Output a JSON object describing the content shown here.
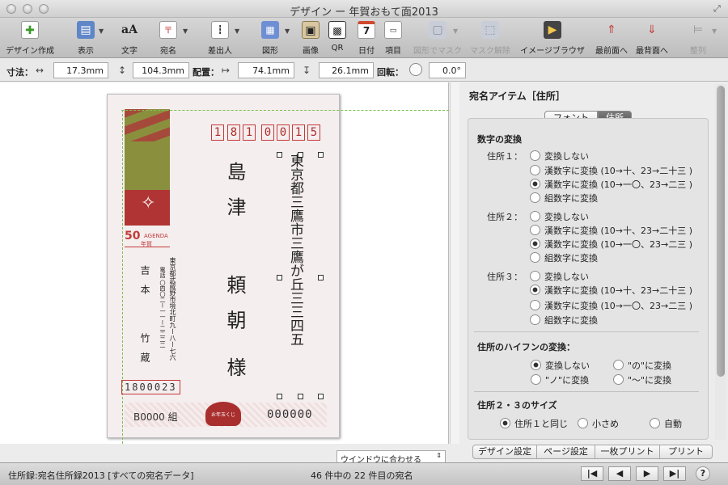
{
  "window": {
    "title": "デザイン ー 年賀おもて面2013"
  },
  "toolbar": {
    "items": [
      {
        "label": "デザイン作成",
        "icon": "design-create-icon"
      },
      {
        "label": "表示",
        "icon": "view-icon"
      },
      {
        "label": "文字",
        "icon": "text-icon"
      },
      {
        "label": "宛名",
        "icon": "address-icon"
      },
      {
        "label": "差出人",
        "icon": "sender-icon"
      },
      {
        "label": "図形",
        "icon": "shape-icon"
      },
      {
        "label": "画像",
        "icon": "image-icon"
      },
      {
        "label": "QR",
        "icon": "qr-icon"
      },
      {
        "label": "日付",
        "icon": "calendar-icon"
      },
      {
        "label": "項目",
        "icon": "field-icon"
      },
      {
        "label": "図形でマスク",
        "icon": "mask-shape-icon"
      },
      {
        "label": "マスク解除",
        "icon": "mask-release-icon"
      },
      {
        "label": "イメージブラウザ",
        "icon": "image-browser-icon"
      },
      {
        "label": "最前面へ",
        "icon": "bring-front-icon"
      },
      {
        "label": "最背面へ",
        "icon": "send-back-icon"
      },
      {
        "label": "整列",
        "icon": "align-icon"
      }
    ],
    "calendar_day": "7"
  },
  "geometry": {
    "size_label": "寸法：",
    "width": "17.3mm",
    "height": "104.3mm",
    "pos_label": "配置：",
    "x": "74.1mm",
    "y": "26.1mm",
    "rotate_label": "回転：",
    "angle": "0.0°"
  },
  "card": {
    "zip_digits": [
      "1",
      "8",
      "1",
      "0",
      "0",
      "1",
      "5"
    ],
    "address": "東京都三鷹市三鷹が丘三三四五",
    "name_line1": "島 津",
    "name_line2": "頼 朝",
    "honorific": "様",
    "stamp_value": "50",
    "stamp_brand": "AGENDA",
    "stamp_sub": "年賀",
    "sender_address": "東京都武蔵野市境北町九ー八ー七六",
    "sender_tel": "電話 〇四〇二ー一一ー二二二二",
    "sender_name_1": "吉 本",
    "sender_name_2": "竹 蔵",
    "sender_zip": "1800023",
    "group_no": "B0000 組",
    "lottery_no": "000000",
    "seal_text": "お年玉くじ"
  },
  "fit_select": "ウインドウに合わせる",
  "panel": {
    "title": "宛名アイテム［住所］",
    "tabs": [
      "フォント",
      "住所"
    ],
    "active_tab": "住所",
    "num_section": "数字の変換",
    "addr1_label": "住所１：",
    "addr2_label": "住所２：",
    "addr3_label": "住所３：",
    "num_options": [
      "変換しない",
      "漢数字に変換 (10→十、23→二十三 )",
      "漢数字に変換 (10→一〇、23→二三 )",
      "組数字に変換"
    ],
    "addr1_selected": 2,
    "addr2_selected": 2,
    "addr3_selected": 1,
    "hyphen_section": "住所のハイフンの変換：",
    "hyphen_options": [
      "変換しない",
      "\"の\"に変換",
      "\"ノ\"に変換",
      "\"〜\"に変換"
    ],
    "hyphen_selected": 0,
    "size_section": "住所２・３のサイズ",
    "size_options": [
      "住所１と同じ",
      "小さめ",
      "自動"
    ],
    "size_selected": 0,
    "buttons": [
      "デザイン設定",
      "ページ設定",
      "一枚プリント",
      "プリント"
    ]
  },
  "status": {
    "left": "住所録:宛名住所録2013 [すべての宛名データ]",
    "center": "46 件中の 22 件目の宛名"
  },
  "colors": {
    "accent_red": "#c43a3a",
    "stamp_green": "#8a8f3e",
    "guide_green": "#7fbf4f"
  }
}
